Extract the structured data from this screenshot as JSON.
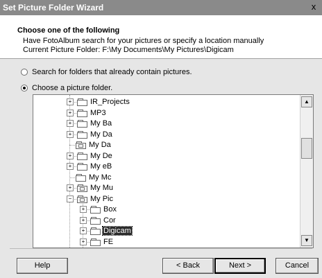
{
  "window": {
    "title": "Set Picture Folder Wizard",
    "close_label": "x"
  },
  "header": {
    "title": "Choose one of the following",
    "description": "Have FotoAlbum search for your pictures or specify a location manually",
    "current_folder": "Current Picture Folder: F:\\My Documents\\My Pictures\\Digicam"
  },
  "options": [
    {
      "label": "Search for folders that already contain pictures.",
      "checked": false
    },
    {
      "label": "Choose a picture folder.",
      "checked": true
    }
  ],
  "tree": {
    "items": [
      {
        "label": "IR_Projects",
        "level": 1,
        "expander": "+",
        "icon": "folder-icon"
      },
      {
        "label": "MP3",
        "level": 1,
        "expander": "+",
        "icon": "folder-icon"
      },
      {
        "label": "My Ba",
        "level": 1,
        "expander": "+",
        "icon": "folder-icon"
      },
      {
        "label": "My Da",
        "level": 1,
        "expander": "+",
        "icon": "folder-icon"
      },
      {
        "label": "My Da",
        "level": 1,
        "expander": "",
        "icon": "special-folder-icon"
      },
      {
        "label": "My De",
        "level": 1,
        "expander": "+",
        "icon": "folder-icon"
      },
      {
        "label": "My eB",
        "level": 1,
        "expander": "+",
        "icon": "folder-icon"
      },
      {
        "label": "My Mc",
        "level": 1,
        "expander": "",
        "icon": "folder-icon"
      },
      {
        "label": "My Mu",
        "level": 1,
        "expander": "+",
        "icon": "special-folder-icon"
      },
      {
        "label": "My Pic",
        "level": 1,
        "expander": "-",
        "icon": "special-folder-icon"
      },
      {
        "label": "Box",
        "level": 2,
        "expander": "+",
        "icon": "folder-icon"
      },
      {
        "label": "Cor",
        "level": 2,
        "expander": "+",
        "icon": "folder-icon"
      },
      {
        "label": "Digicam",
        "level": 2,
        "expander": "+",
        "icon": "folder-icon",
        "selected": true
      },
      {
        "label": "FE",
        "level": 2,
        "expander": "+",
        "icon": "folder-icon"
      }
    ]
  },
  "buttons": {
    "help": "Help",
    "back": "< Back",
    "next": "Next >",
    "cancel": "Cancel"
  }
}
